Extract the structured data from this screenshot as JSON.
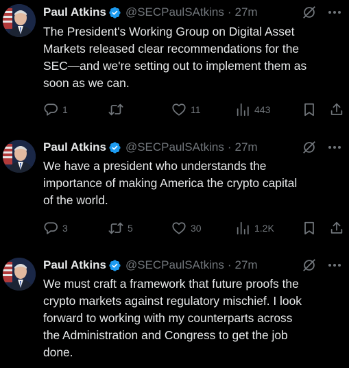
{
  "author": {
    "name": "Paul Atkins",
    "handle": "@SECPaulSAtkins"
  },
  "separator": "·",
  "colors": {
    "background": "#000000",
    "text": "#e7e9ea",
    "muted": "#71767b",
    "verified_badge": "#1d9bf0"
  },
  "icons": {
    "verified": "verified-badge-icon",
    "grok": "grok-icon",
    "more": "more-icon",
    "reply": "reply-icon",
    "retweet": "retweet-icon",
    "like": "heart-icon",
    "views": "views-icon",
    "bookmark": "bookmark-icon",
    "share": "share-icon"
  },
  "tweets": [
    {
      "time": "27m",
      "lines": [
        "The President's Working Group on Digital Asset",
        "Markets released clear recommendations for the",
        "SEC—and we're setting out to implement them as",
        "soon as we can."
      ],
      "reply_count": "1",
      "retweet_count": "",
      "like_count": "11",
      "view_count": "443"
    },
    {
      "time": "27m",
      "lines": [
        "We have a president who understands the",
        "importance of making America the crypto capital",
        "of the world."
      ],
      "reply_count": "3",
      "retweet_count": "5",
      "like_count": "30",
      "view_count": "1.2K"
    },
    {
      "time": "27m",
      "lines": [
        "We must craft a framework that future proofs the",
        "crypto markets against regulatory mischief. I look",
        "forward to working with my counterparts across",
        "the Administration and Congress to get the job",
        "done."
      ]
    }
  ]
}
